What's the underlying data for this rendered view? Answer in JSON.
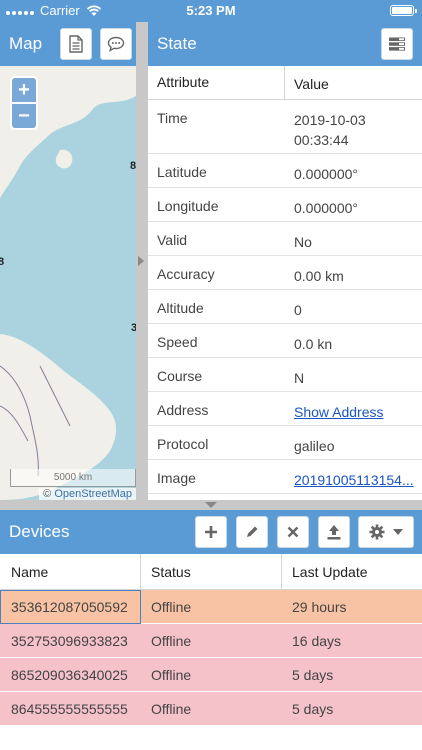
{
  "status_bar": {
    "carrier": "Carrier",
    "time": "5:23 PM"
  },
  "map": {
    "title": "Map",
    "zoom_in": "+",
    "zoom_out": "−",
    "scale_label": "5000 km",
    "attribution_prefix": "©",
    "attribution_link": "OpenStreetMap",
    "edge_labels": [
      "8",
      "8",
      "3"
    ]
  },
  "state": {
    "title": "State",
    "columns": {
      "attribute": "Attribute",
      "value": "Value"
    },
    "rows": [
      {
        "attribute": "Time",
        "value": "2019-10-03 00:33:44",
        "link": false
      },
      {
        "attribute": "Latitude",
        "value": "0.000000°",
        "link": false
      },
      {
        "attribute": "Longitude",
        "value": "0.000000°",
        "link": false
      },
      {
        "attribute": "Valid",
        "value": "No",
        "link": false
      },
      {
        "attribute": "Accuracy",
        "value": "0.00 km",
        "link": false
      },
      {
        "attribute": "Altitude",
        "value": "0",
        "link": false
      },
      {
        "attribute": "Speed",
        "value": "0.0 kn",
        "link": false
      },
      {
        "attribute": "Course",
        "value": "N",
        "link": false
      },
      {
        "attribute": "Address",
        "value": "Show Address",
        "link": true
      },
      {
        "attribute": "Protocol",
        "value": "galileo",
        "link": false
      },
      {
        "attribute": "Image",
        "value": "20191005113154...",
        "link": true
      }
    ]
  },
  "devices": {
    "title": "Devices",
    "columns": {
      "name": "Name",
      "status": "Status",
      "last_update": "Last Update"
    },
    "rows": [
      {
        "name": "353612087050592",
        "status": "Offline",
        "last_update": "29 hours",
        "color": "#f8c2a4",
        "selected": true
      },
      {
        "name": "352753096933823",
        "status": "Offline",
        "last_update": "16 days",
        "color": "#f4c2c8",
        "selected": false
      },
      {
        "name": "865209036340025",
        "status": "Offline",
        "last_update": "5 days",
        "color": "#f4c2c8",
        "selected": false
      },
      {
        "name": "864555555555555",
        "status": "Offline",
        "last_update": "5 days",
        "color": "#f4c2c8",
        "selected": false
      }
    ]
  },
  "colors": {
    "header": "#5b9bd5",
    "link": "#1a55c4",
    "offline_recent": "#f8c2a4",
    "offline_old": "#f4c2c8"
  }
}
